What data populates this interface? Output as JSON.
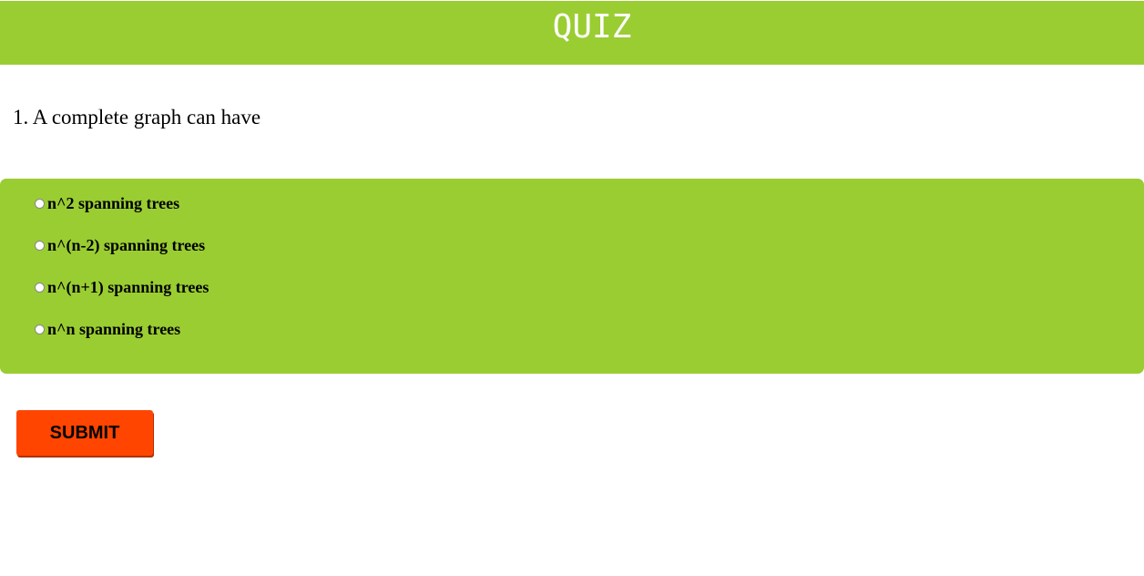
{
  "header": {
    "title": "QUIZ"
  },
  "question": {
    "text": "1. A complete graph can have"
  },
  "options": [
    {
      "label": "n^2 spanning trees",
      "selected": false
    },
    {
      "label": "n^(n-2) spanning trees",
      "selected": false
    },
    {
      "label": "n^(n+1) spanning trees",
      "selected": false
    },
    {
      "label": "n^n spanning trees",
      "selected": false
    }
  ],
  "submit": {
    "label": "SUBMIT"
  },
  "colors": {
    "accent": "#9acd32",
    "button": "#ff4500"
  }
}
